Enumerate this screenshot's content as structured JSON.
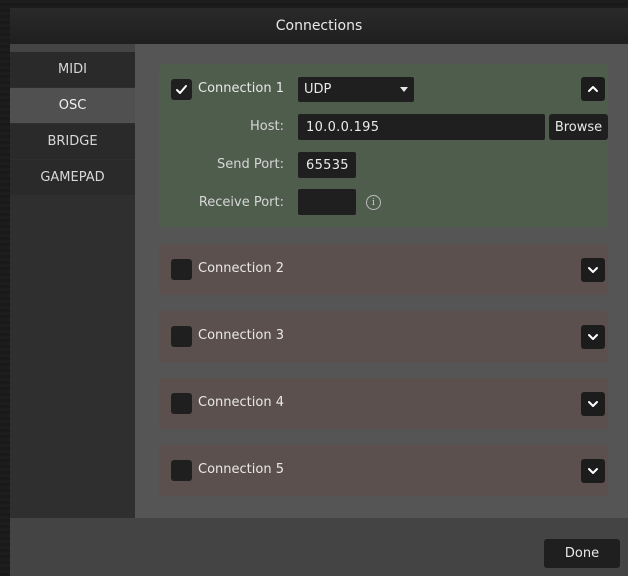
{
  "dialog": {
    "title": "Connections"
  },
  "tabs": [
    {
      "label": "MIDI",
      "active": false
    },
    {
      "label": "OSC",
      "active": true
    },
    {
      "label": "BRIDGE",
      "active": false
    },
    {
      "label": "GAMEPAD",
      "active": false
    }
  ],
  "connections": [
    {
      "label": "Connection 1",
      "enabled": true,
      "expanded": true,
      "protocol": "UDP",
      "host_label": "Host:",
      "host": "10.0.0.195",
      "browse_label": "Browse",
      "send_port_label": "Send Port:",
      "send_port": "65535",
      "receive_port_label": "Receive Port:",
      "receive_port": ""
    },
    {
      "label": "Connection 2",
      "enabled": false,
      "expanded": false
    },
    {
      "label": "Connection 3",
      "enabled": false,
      "expanded": false
    },
    {
      "label": "Connection 4",
      "enabled": false,
      "expanded": false
    },
    {
      "label": "Connection 5",
      "enabled": false,
      "expanded": false
    }
  ],
  "footer": {
    "done_label": "Done"
  },
  "icons": {
    "checkmark": "check-icon",
    "collapse": "chevron-up-icon",
    "expand": "chevron-down-icon",
    "dropdown": "caret-down-icon",
    "info": "info-icon"
  },
  "colors": {
    "expanded_panel": "#4f5d4d",
    "collapsed_panel": "#5c504e",
    "content_bg": "#555555",
    "sidebar_bg": "#2f2f2f",
    "active_tab": "#505050"
  }
}
